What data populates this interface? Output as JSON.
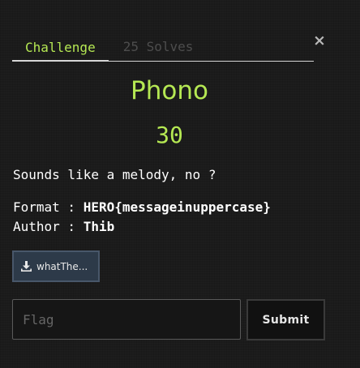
{
  "modal": {
    "close_symbol": "×",
    "tabs": [
      {
        "label": "Challenge",
        "active": true
      },
      {
        "label": "25 Solves",
        "active": false
      }
    ],
    "challenge": {
      "name": "Phono",
      "points": "30",
      "description": "Sounds like a melody, no ?",
      "format_label": "Format : ",
      "format_value": "HERO{messageinuppercase}",
      "author_label": "Author : ",
      "author_value": "Thib"
    },
    "file": {
      "label": "whatThe...",
      "icon": "download-icon"
    },
    "flag_input": {
      "placeholder": "Flag",
      "value": ""
    },
    "submit_label": "Submit"
  },
  "colors": {
    "accent": "#b5e853",
    "background": "#1b1b1b",
    "file_button": "#2d3a49"
  }
}
